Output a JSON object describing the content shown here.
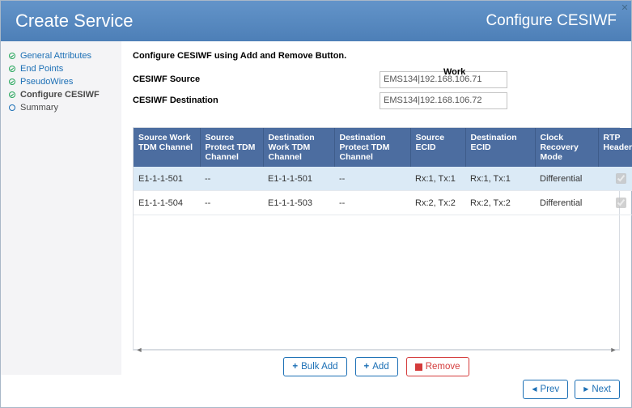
{
  "header": {
    "title_left": "Create Service",
    "title_right": "Configure CESIWF"
  },
  "sidebar": {
    "items": [
      {
        "label": "General Attributes",
        "state": "done"
      },
      {
        "label": "End Points",
        "state": "done"
      },
      {
        "label": "PseudoWires",
        "state": "done"
      },
      {
        "label": "Configure CESIWF",
        "state": "current"
      },
      {
        "label": "Summary",
        "state": "future"
      }
    ]
  },
  "form": {
    "instruction": "Configure CESIWF using Add and Remove Button.",
    "work_label": "Work",
    "rows": [
      {
        "label": "CESIWF Source",
        "value": "EMS134|192.168.106.71"
      },
      {
        "label": "CESIWF Destination",
        "value": "EMS134|192.168.106.72"
      }
    ]
  },
  "table": {
    "headers": [
      "Source Work TDM Channel",
      "Source Protect TDM Channel",
      "Destination Work TDM Channel",
      "Destination Protect TDM Channel",
      "Source ECID",
      "Destination ECID",
      "Clock Recovery Mode",
      "RTP Header"
    ],
    "rows": [
      {
        "c0": "E1-1-1-501",
        "c1": "--",
        "c2": "E1-1-1-501",
        "c3": "--",
        "c4": "Rx:1, Tx:1",
        "c5": "Rx:1, Tx:1",
        "c6": "Differential",
        "rtp": true,
        "selected": true
      },
      {
        "c0": "E1-1-1-504",
        "c1": "--",
        "c2": "E1-1-1-503",
        "c3": "--",
        "c4": "Rx:2, Tx:2",
        "c5": "Rx:2, Tx:2",
        "c6": "Differential",
        "rtp": true,
        "selected": false
      }
    ]
  },
  "actions": {
    "bulk_add": "Bulk Add",
    "add": "Add",
    "remove": "Remove"
  },
  "footer": {
    "prev": "Prev",
    "next": "Next"
  }
}
